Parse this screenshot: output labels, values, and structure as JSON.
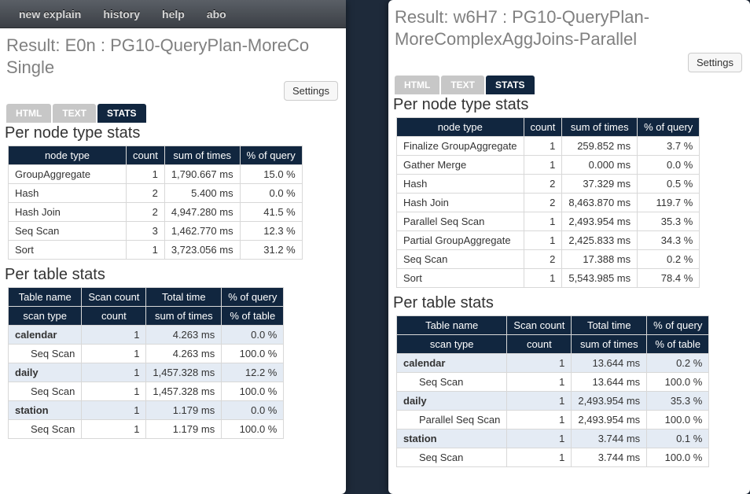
{
  "nav": {
    "items": [
      "new explain",
      "history",
      "help",
      "abo"
    ]
  },
  "settings_label": "Settings",
  "tabs": [
    "HTML",
    "TEXT",
    "STATS"
  ],
  "active_tab": "STATS",
  "sections": {
    "per_node": "Per node type stats",
    "per_table": "Per table stats"
  },
  "nt_headers": [
    "node type",
    "count",
    "sum of times",
    "% of query"
  ],
  "pt_headers_top": [
    "Table name",
    "Scan count",
    "Total time",
    "% of query"
  ],
  "pt_headers_sub": [
    "scan type",
    "count",
    "sum of times",
    "% of table"
  ],
  "left": {
    "title": "Result: E0n : PG10-QueryPlan-MoreCo            Single",
    "node_rows": [
      {
        "t": "GroupAggregate",
        "c": "1",
        "s": "1,790.667 ms",
        "p": "15.0 %"
      },
      {
        "t": "Hash",
        "c": "2",
        "s": "5.400 ms",
        "p": "0.0 %"
      },
      {
        "t": "Hash Join",
        "c": "2",
        "s": "4,947.280 ms",
        "p": "41.5 %"
      },
      {
        "t": "Seq Scan",
        "c": "3",
        "s": "1,462.770 ms",
        "p": "12.3 %"
      },
      {
        "t": "Sort",
        "c": "1",
        "s": "3,723.056 ms",
        "p": "31.2 %"
      }
    ],
    "table_rows": [
      {
        "kind": "tbl",
        "n": "calendar",
        "c": "1",
        "t": "4.263 ms",
        "p": "0.0 %"
      },
      {
        "kind": "scan",
        "n": "Seq Scan",
        "c": "1",
        "t": "4.263 ms",
        "p": "100.0 %"
      },
      {
        "kind": "tbl",
        "n": "daily",
        "c": "1",
        "t": "1,457.328 ms",
        "p": "12.2 %"
      },
      {
        "kind": "scan",
        "n": "Seq Scan",
        "c": "1",
        "t": "1,457.328 ms",
        "p": "100.0 %"
      },
      {
        "kind": "tbl",
        "n": "station",
        "c": "1",
        "t": "1.179 ms",
        "p": "0.0 %"
      },
      {
        "kind": "scan",
        "n": "Seq Scan",
        "c": "1",
        "t": "1.179 ms",
        "p": "100.0 %"
      }
    ]
  },
  "right": {
    "title": "Result: w6H7 : PG10-QueryPlan-MoreComplexAggJoins-Parallel",
    "node_rows": [
      {
        "t": "Finalize GroupAggregate",
        "c": "1",
        "s": "259.852 ms",
        "p": "3.7 %"
      },
      {
        "t": "Gather Merge",
        "c": "1",
        "s": "0.000 ms",
        "p": "0.0 %"
      },
      {
        "t": "Hash",
        "c": "2",
        "s": "37.329 ms",
        "p": "0.5 %"
      },
      {
        "t": "Hash Join",
        "c": "2",
        "s": "8,463.870 ms",
        "p": "119.7 %"
      },
      {
        "t": "Parallel Seq Scan",
        "c": "1",
        "s": "2,493.954 ms",
        "p": "35.3 %"
      },
      {
        "t": "Partial GroupAggregate",
        "c": "1",
        "s": "2,425.833 ms",
        "p": "34.3 %"
      },
      {
        "t": "Seq Scan",
        "c": "2",
        "s": "17.388 ms",
        "p": "0.2 %"
      },
      {
        "t": "Sort",
        "c": "1",
        "s": "5,543.985 ms",
        "p": "78.4 %"
      }
    ],
    "table_rows": [
      {
        "kind": "tbl",
        "n": "calendar",
        "c": "1",
        "t": "13.644 ms",
        "p": "0.2 %"
      },
      {
        "kind": "scan",
        "n": "Seq Scan",
        "c": "1",
        "t": "13.644 ms",
        "p": "100.0 %"
      },
      {
        "kind": "tbl",
        "n": "daily",
        "c": "1",
        "t": "2,493.954 ms",
        "p": "35.3 %"
      },
      {
        "kind": "scan",
        "n": "Parallel Seq Scan",
        "c": "1",
        "t": "2,493.954 ms",
        "p": "100.0 %"
      },
      {
        "kind": "tbl",
        "n": "station",
        "c": "1",
        "t": "3.744 ms",
        "p": "0.1 %"
      },
      {
        "kind": "scan",
        "n": "Seq Scan",
        "c": "1",
        "t": "3.744 ms",
        "p": "100.0 %"
      }
    ]
  }
}
